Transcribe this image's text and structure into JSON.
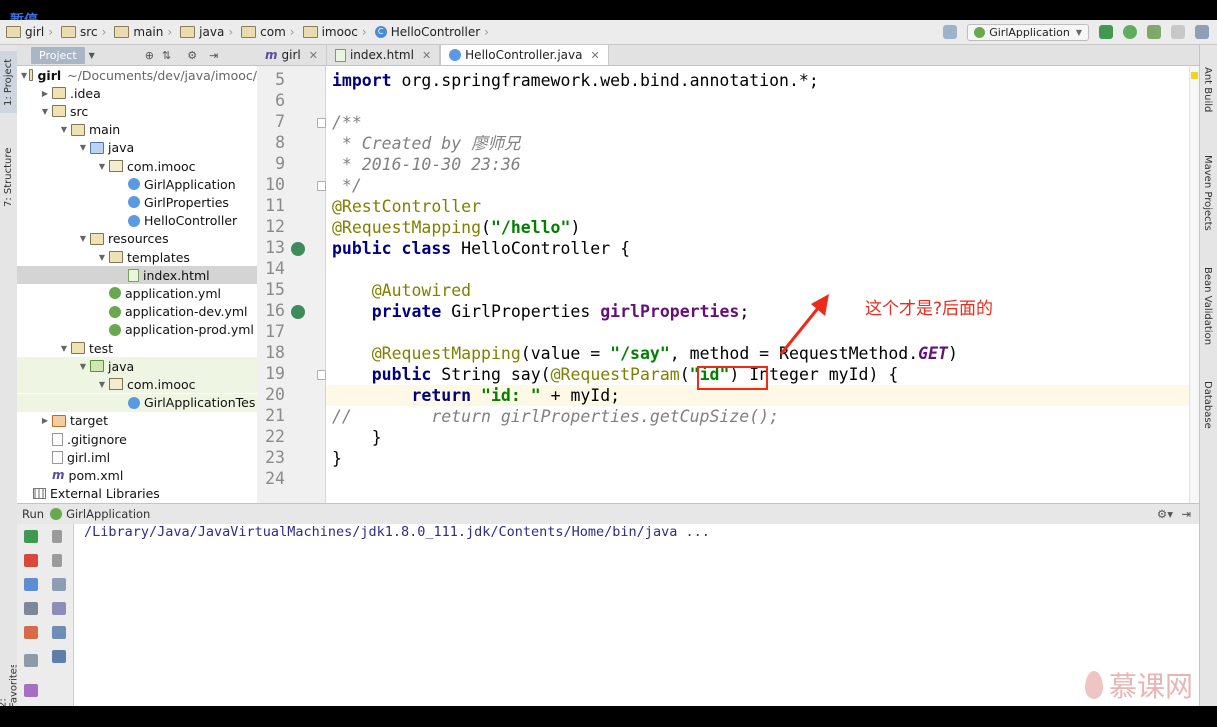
{
  "overlay": {
    "pause_label": "暂停"
  },
  "breadcrumb": [
    "girl",
    "src",
    "main",
    "java",
    "com",
    "imooc",
    "HelloController"
  ],
  "toolbar": {
    "run_config": "GirlApplication"
  },
  "project_panel": {
    "tab": "Project",
    "tree": [
      {
        "label": "girl",
        "suffix": "~/Documents/dev/java/imooc/",
        "depth": 0,
        "arrow": "▼",
        "icon": "folder",
        "bold": true
      },
      {
        "label": ".idea",
        "depth": 1,
        "arrow": "▶",
        "icon": "folder"
      },
      {
        "label": "src",
        "depth": 1,
        "arrow": "▼",
        "icon": "folder"
      },
      {
        "label": "main",
        "depth": 2,
        "arrow": "▼",
        "icon": "folder"
      },
      {
        "label": "java",
        "depth": 3,
        "arrow": "▼",
        "icon": "folder blue"
      },
      {
        "label": "com.imooc",
        "depth": 4,
        "arrow": "▼",
        "icon": "pkg"
      },
      {
        "label": "GirlApplication",
        "depth": 5,
        "arrow": "",
        "icon": "cls"
      },
      {
        "label": "GirlProperties",
        "depth": 5,
        "arrow": "",
        "icon": "cls"
      },
      {
        "label": "HelloController",
        "depth": 5,
        "arrow": "",
        "icon": "cls"
      },
      {
        "label": "resources",
        "depth": 3,
        "arrow": "▼",
        "icon": "folder"
      },
      {
        "label": "templates",
        "depth": 4,
        "arrow": "▼",
        "icon": "folder"
      },
      {
        "label": "index.html",
        "depth": 5,
        "arrow": "",
        "icon": "html",
        "selected": true
      },
      {
        "label": "application.yml",
        "depth": 4,
        "arrow": "",
        "icon": "spring"
      },
      {
        "label": "application-dev.yml",
        "depth": 4,
        "arrow": "",
        "icon": "spring"
      },
      {
        "label": "application-prod.yml",
        "depth": 4,
        "arrow": "",
        "icon": "spring"
      },
      {
        "label": "test",
        "depth": 2,
        "arrow": "▼",
        "icon": "folder"
      },
      {
        "label": "java",
        "depth": 3,
        "arrow": "▼",
        "icon": "folder green",
        "test": true
      },
      {
        "label": "com.imooc",
        "depth": 4,
        "arrow": "▼",
        "icon": "pkg",
        "test": true
      },
      {
        "label": "GirlApplicationTes",
        "depth": 5,
        "arrow": "",
        "icon": "cls",
        "test": true
      },
      {
        "label": "target",
        "depth": 1,
        "arrow": "▶",
        "icon": "folder orange"
      },
      {
        "label": ".gitignore",
        "depth": 1,
        "arrow": "",
        "icon": "file"
      },
      {
        "label": "girl.iml",
        "depth": 1,
        "arrow": "",
        "icon": "file"
      },
      {
        "label": "pom.xml",
        "depth": 1,
        "arrow": "",
        "icon": "maven"
      },
      {
        "label": "External Libraries",
        "depth": 0,
        "arrow": "",
        "icon": "lib"
      }
    ]
  },
  "editor_tabs": [
    {
      "label": "girl",
      "icon": "m"
    },
    {
      "label": "index.html",
      "icon": "html"
    },
    {
      "label": "HelloController.java",
      "icon": "cls",
      "active": true
    }
  ],
  "code_lines": [
    {
      "n": "5",
      "html": "<span class='kw'>import</span> org.springframework.web.bind.annotation.*;"
    },
    {
      "n": "6",
      "html": ""
    },
    {
      "n": "7",
      "html": "<span class='cmt'>/**</span>"
    },
    {
      "n": "8",
      "html": "<span class='cmt'> * Created by 廖师兄</span>"
    },
    {
      "n": "9",
      "html": "<span class='cmt'> * 2016-10-30 23:36</span>"
    },
    {
      "n": "10",
      "html": "<span class='cmt'> */</span>"
    },
    {
      "n": "11",
      "html": "<span class='ann'>@RestController</span>"
    },
    {
      "n": "12",
      "html": "<span class='ann'>@RequestMapping</span>(<span class='str'>\"/hello\"</span>)"
    },
    {
      "n": "13",
      "html": "<span class='kw'>public class</span> HelloController {"
    },
    {
      "n": "14",
      "html": ""
    },
    {
      "n": "15",
      "html": "    <span class='ann'>@Autowired</span>"
    },
    {
      "n": "16",
      "html": "    <span class='kw'>private</span> GirlProperties <span class='fld'>girlProperties</span>;"
    },
    {
      "n": "17",
      "html": ""
    },
    {
      "n": "18",
      "html": "    <span class='ann'>@RequestMapping</span>(value = <span class='str'>\"/say\"</span>, method = RequestMethod.<span class='cnst'>GET</span>)"
    },
    {
      "n": "19",
      "html": "    <span class='kw'>public</span> String say(<span class='ann'>@RequestParam</span>(<span class='str'>\"id\"</span>) Integer myId) {"
    },
    {
      "n": "20",
      "html": "        <span class='kw'>return</span> <span class='str'>\"id: \"</span> + myId;"
    },
    {
      "n": "21",
      "html": "<span class='cmt'>//        return girlProperties.getCupSize();</span>"
    },
    {
      "n": "22",
      "html": "    }"
    },
    {
      "n": "23",
      "html": "}"
    },
    {
      "n": "24",
      "html": ""
    }
  ],
  "annotation_note": "这个才是?后面的",
  "side_tabs": {
    "left": [
      "1: Project",
      "7: Structure",
      "2: Favorites"
    ],
    "right": [
      "Ant Build",
      "Maven Projects",
      "Bean Validation",
      "Database"
    ]
  },
  "run_panel": {
    "label": "Run",
    "config": "GirlApplication",
    "console": "/Library/Java/JavaVirtualMachines/jdk1.8.0_111.jdk/Contents/Home/bin/java ..."
  },
  "watermark": "慕课网",
  "colors": {
    "highlight_box": "#ee2a1a",
    "annotation_text": "#ee2a1a",
    "keyword": "#000080",
    "string": "#008000",
    "annotation": "#808000"
  }
}
